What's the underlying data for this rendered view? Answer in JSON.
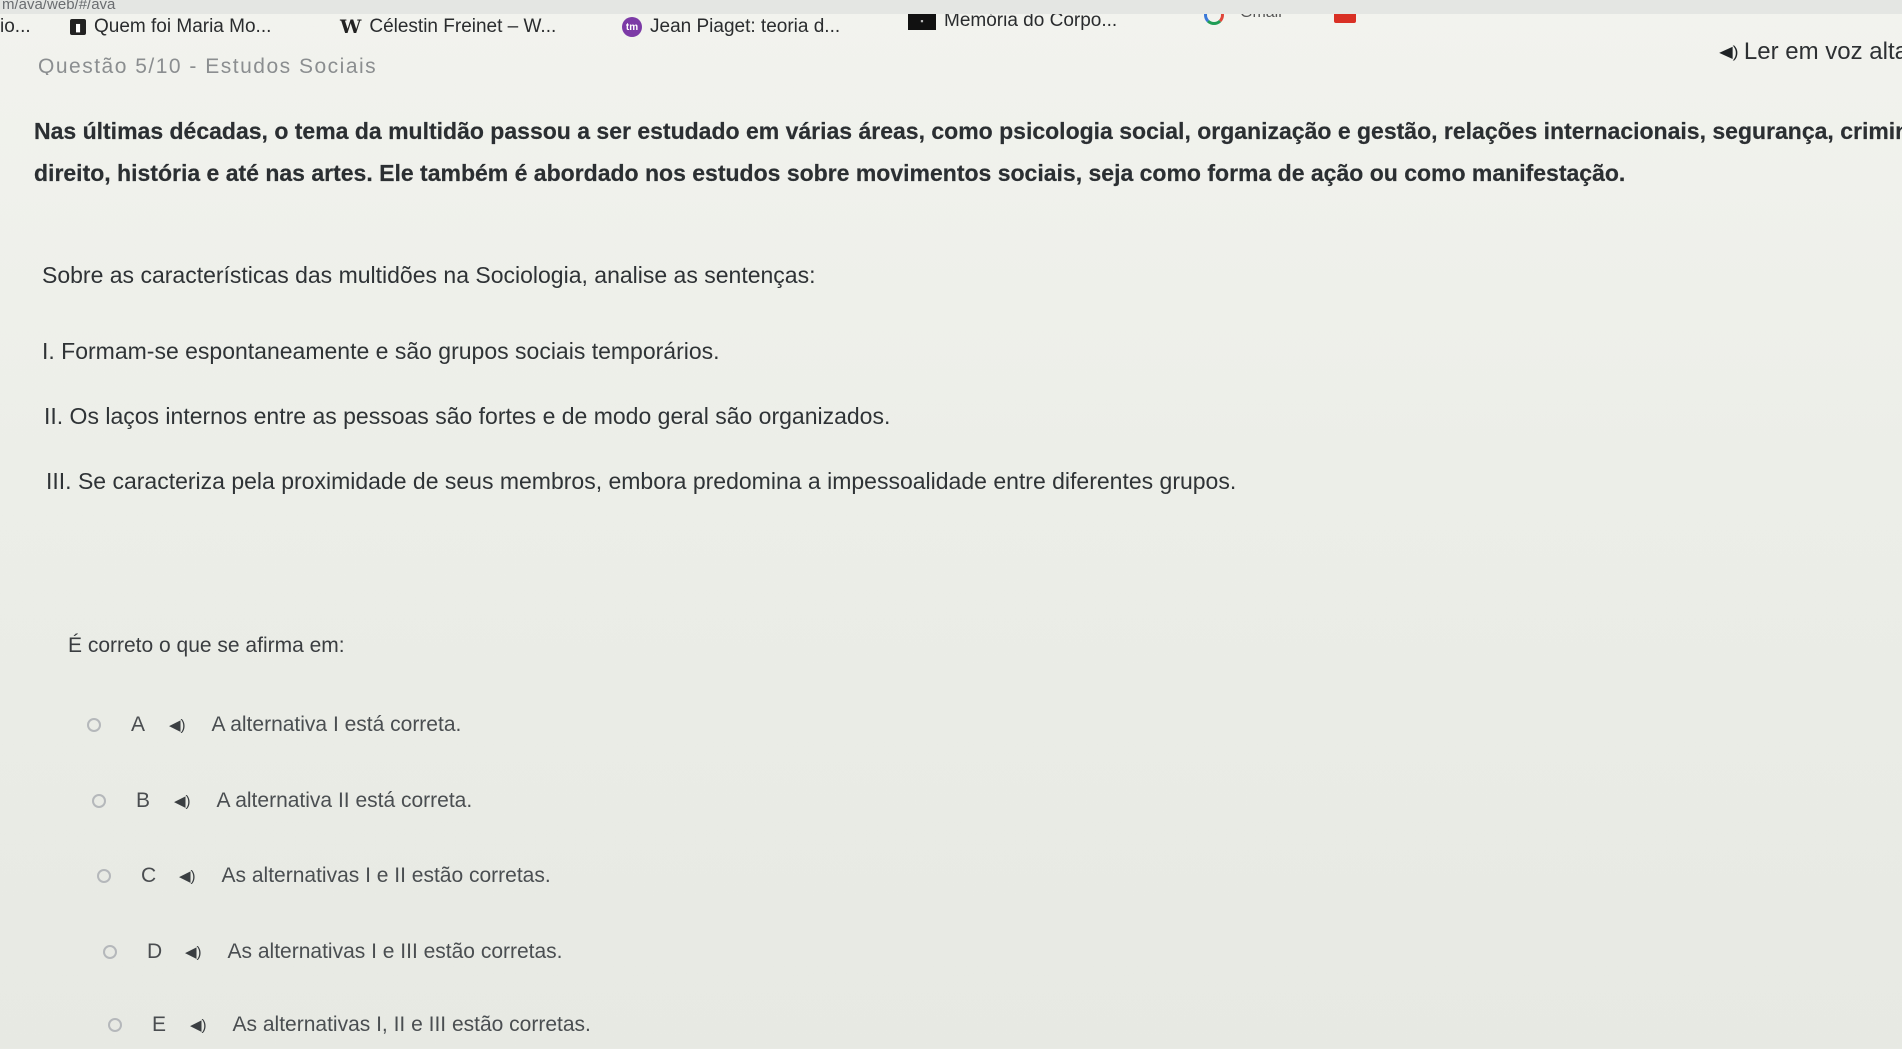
{
  "browser": {
    "url_fragment": "m/ava/web/#/ava",
    "bookmarks": [
      {
        "label": "io...",
        "icon": ""
      },
      {
        "label": "Quem foi Maria Mo...",
        "icon": "document-icon"
      },
      {
        "label": "Célestin Freinet – W...",
        "icon": "wikipedia-icon"
      },
      {
        "label": "Jean Piaget: teoria d...",
        "icon": "tm-logo-icon"
      },
      {
        "label": "Memória do Corpo...",
        "icon": "video-thumbnail-icon"
      },
      {
        "label": "",
        "icon": "google-icon"
      },
      {
        "label": "Gmail",
        "icon": "gmail-icon"
      }
    ]
  },
  "header": {
    "section_title": "Questão 5/10 - Estudos Sociais",
    "read_aloud": "Ler em voz alta"
  },
  "content": {
    "paragraph_line1": "Nas últimas décadas, o tema da multidão passou a ser estudado em várias áreas, como psicologia social, organização e gestão, relações internacionais, segurança, criminologia,",
    "paragraph_line2": "direito, história e até nas artes. Ele também é abordado nos estudos sobre movimentos sociais, seja como forma de ação ou como manifestação.",
    "prompt": "Sobre as características das multidões na Sociologia, analise as sentenças:",
    "statements": [
      "I. Formam-se espontaneamente e são grupos sociais temporários.",
      "II. Os laços internos entre as pessoas são fortes e de modo geral são organizados.",
      "III. Se caracteriza pela proximidade de seus membros, embora predomina a impessoalidade entre diferentes grupos."
    ],
    "question": "É correto o que se afirma em:"
  },
  "options": [
    {
      "letter": "A",
      "text": "A alternativa I está correta."
    },
    {
      "letter": "B",
      "text": "A alternativa II está correta."
    },
    {
      "letter": "C",
      "text": "As alternativas I e II estão corretas."
    },
    {
      "letter": "D",
      "text": "As alternativas I e III estão corretas."
    },
    {
      "letter": "E",
      "text": "As alternativas I, II e III estão corretas."
    }
  ],
  "colors": {
    "background": "#eceee8",
    "text": "#2b2f32",
    "radio_border": "#b5b8bb"
  }
}
